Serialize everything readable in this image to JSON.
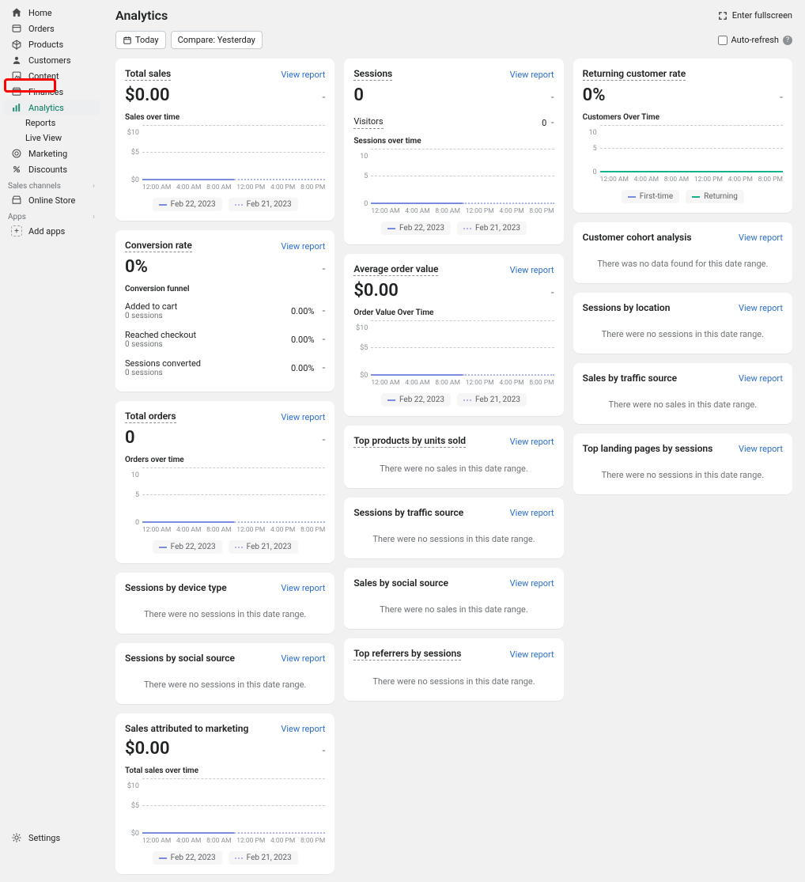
{
  "sidebar": {
    "items": [
      {
        "label": "Home",
        "icon": "home"
      },
      {
        "label": "Orders",
        "icon": "orders"
      },
      {
        "label": "Products",
        "icon": "products"
      },
      {
        "label": "Customers",
        "icon": "customers"
      },
      {
        "label": "Content",
        "icon": "content"
      },
      {
        "label": "Finances",
        "icon": "finances"
      },
      {
        "label": "Analytics",
        "icon": "analytics"
      }
    ],
    "analytics_sub": [
      {
        "label": "Reports"
      },
      {
        "label": "Live View"
      }
    ],
    "bottom_items": [
      {
        "label": "Marketing",
        "icon": "marketing"
      },
      {
        "label": "Discounts",
        "icon": "discounts"
      }
    ],
    "sales_channels_label": "Sales channels",
    "online_store_label": "Online Store",
    "apps_label": "Apps",
    "add_apps_label": "Add apps",
    "settings_label": "Settings"
  },
  "header": {
    "title": "Analytics",
    "enter_fullscreen": "Enter fullscreen",
    "today_btn": "Today",
    "compare_btn": "Compare: Yesterday",
    "auto_refresh": "Auto-refresh"
  },
  "links": {
    "view_report": "View report"
  },
  "dates": {
    "current": "Feb 22, 2023",
    "previous": "Feb 21, 2023"
  },
  "ret_legend": {
    "first": "First-time",
    "returning": "Returning"
  },
  "cards": {
    "total_sales": {
      "title": "Total sales",
      "value": "$0.00",
      "chart_label": "Sales over time"
    },
    "sessions": {
      "title": "Sessions",
      "value": "0",
      "visitors_label": "Visitors",
      "visitors_value": "0",
      "chart_label": "Sessions over time"
    },
    "returning": {
      "title": "Returning customer rate",
      "value": "0%",
      "chart_label": "Customers Over Time"
    },
    "conversion": {
      "title": "Conversion rate",
      "value": "0%",
      "funnel_label": "Conversion funnel",
      "rows": [
        {
          "t": "Added to cart",
          "s": "0 sessions",
          "p": "0.00%"
        },
        {
          "t": "Reached checkout",
          "s": "0 sessions",
          "p": "0.00%"
        },
        {
          "t": "Sessions converted",
          "s": "0 sessions",
          "p": "0.00%"
        }
      ]
    },
    "aov": {
      "title": "Average order value",
      "value": "$0.00",
      "chart_label": "Order Value Over Time"
    },
    "cohort": {
      "title": "Customer cohort analysis",
      "empty": "There was no data found for this date range."
    },
    "total_orders": {
      "title": "Total orders",
      "value": "0",
      "chart_label": "Orders over time"
    },
    "sessions_loc": {
      "title": "Sessions by location",
      "empty": "There were no sessions in this date range."
    },
    "sales_traffic": {
      "title": "Sales by traffic source",
      "empty": "There were no sales in this date range."
    },
    "top_products": {
      "title": "Top products by units sold",
      "empty": "There were no sales in this date range."
    },
    "landing": {
      "title": "Top landing pages by sessions",
      "empty": "There were no sessions in this date range."
    },
    "sess_device": {
      "title": "Sessions by device type",
      "empty": "There were no sessions in this date range."
    },
    "sess_traffic": {
      "title": "Sessions by traffic source",
      "empty": "There were no sessions in this date range."
    },
    "sales_social": {
      "title": "Sales by social source",
      "empty": "There were no sales in this date range."
    },
    "sess_social": {
      "title": "Sessions by social source",
      "empty": "There were no sessions in this date range."
    },
    "top_ref": {
      "title": "Top referrers by sessions",
      "empty": "There were no sessions in this date range."
    },
    "sales_marketing": {
      "title": "Sales attributed to marketing",
      "value": "$0.00",
      "chart_label": "Total sales over time"
    }
  },
  "chart_data": {
    "type": "line",
    "title": "Sales over time",
    "xlabel": "",
    "ylabel": "",
    "x_ticks": [
      "12:00 AM",
      "4:00 AM",
      "8:00 AM",
      "12:00 PM",
      "4:00 PM",
      "8:00 PM"
    ],
    "y_ticks_sales": [
      "$0",
      "$5",
      "$10"
    ],
    "y_ticks_count": [
      "0",
      "5",
      "10"
    ],
    "series": [
      {
        "name": "Feb 22, 2023",
        "values": [
          0,
          0,
          0,
          0,
          0,
          0
        ],
        "style": "solid",
        "color": "#7b8ce0"
      },
      {
        "name": "Feb 21, 2023",
        "values": [
          0,
          0,
          0,
          0,
          0,
          0
        ],
        "style": "dotted",
        "color": "#b0b7e8"
      }
    ],
    "ylim": [
      0,
      10
    ]
  }
}
